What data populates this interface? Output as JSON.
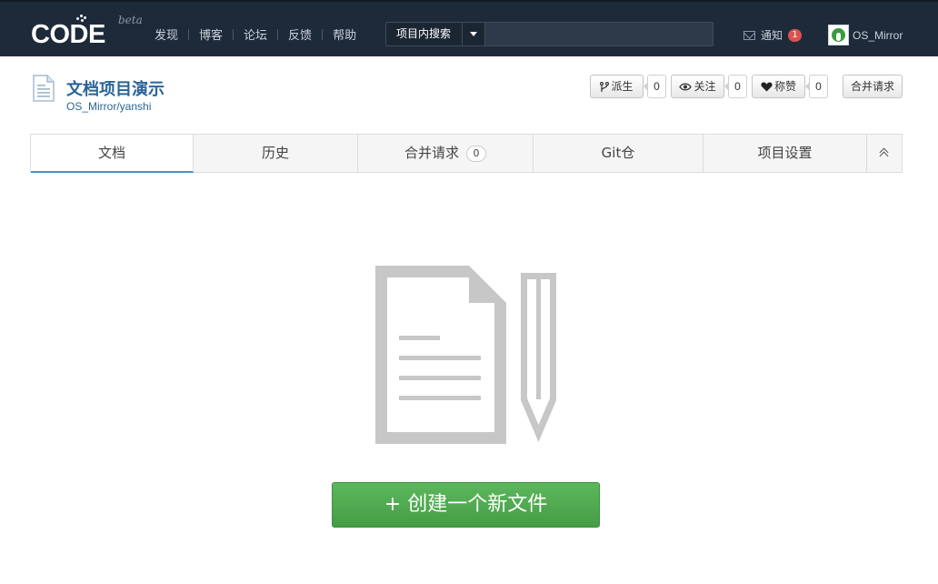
{
  "topbar": {
    "logo_text": "CODE",
    "logo_beta": "beta",
    "nav": [
      "发现",
      "博客",
      "论坛",
      "反馈",
      "帮助"
    ],
    "search": {
      "scope_label": "项目内搜索",
      "placeholder": ""
    },
    "notify": {
      "label": "通知",
      "count": "1"
    },
    "user": {
      "name": "OS_Mirror"
    }
  },
  "project": {
    "title": "文档项目演示",
    "path": "OS_Mirror/yanshi",
    "actions": {
      "fork_label": "派生",
      "fork_count": "0",
      "watch_label": "关注",
      "watch_count": "0",
      "star_label": "称赞",
      "star_count": "0",
      "merge_label": "合并请求"
    }
  },
  "tabs": [
    {
      "label": "文档",
      "active": true
    },
    {
      "label": "历史"
    },
    {
      "label": "合并请求",
      "count": "0"
    },
    {
      "label": "Git仓"
    },
    {
      "label": "项目设置"
    }
  ],
  "empty_state": {
    "create_label": "+ 创建一个新文件"
  },
  "colors": {
    "topbar": "#1d2a3a",
    "link": "#2a6496",
    "create_button": "#5cb85c",
    "badge": "#d9534f"
  }
}
